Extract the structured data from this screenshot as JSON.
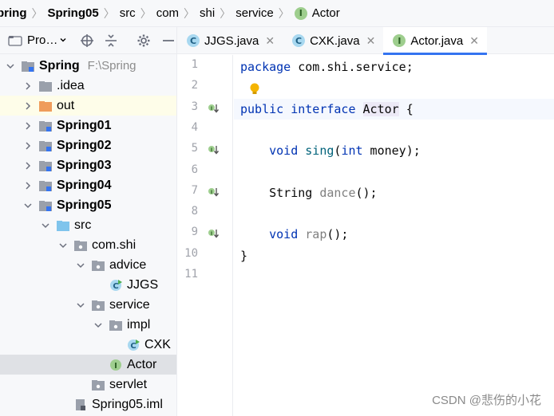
{
  "breadcrumb": {
    "items": [
      {
        "label": "pring",
        "bold": true
      },
      {
        "label": "Spring05",
        "bold": true
      },
      {
        "label": "src",
        "bold": false
      },
      {
        "label": "com",
        "bold": false
      },
      {
        "label": "shi",
        "bold": false
      },
      {
        "label": "service",
        "bold": false
      }
    ],
    "current": {
      "label": "Actor",
      "icon": "interface-icon"
    }
  },
  "project_panel": {
    "title": "Pro…",
    "toolbar": [
      "locate-icon",
      "collapse-all-icon",
      "gear-icon",
      "minimize-icon"
    ],
    "tree": [
      {
        "label": "Spring",
        "hint": "F:\\Spring",
        "bold": true,
        "expanded": true,
        "icon": "module-folder"
      },
      {
        "label": ".idea",
        "bold": false,
        "expanded": false,
        "icon": "folder"
      },
      {
        "label": "out",
        "bold": false,
        "expanded": false,
        "icon": "excluded-folder",
        "highlight": true
      },
      {
        "label": "Spring01",
        "bold": true,
        "expanded": false,
        "icon": "module-folder"
      },
      {
        "label": "Spring02",
        "bold": true,
        "expanded": false,
        "icon": "module-folder"
      },
      {
        "label": "Spring03",
        "bold": true,
        "expanded": false,
        "icon": "module-folder"
      },
      {
        "label": "Spring04",
        "bold": true,
        "expanded": false,
        "icon": "module-folder"
      },
      {
        "label": "Spring05",
        "bold": true,
        "expanded": true,
        "icon": "module-folder"
      },
      {
        "label": "src",
        "bold": false,
        "expanded": true,
        "icon": "source-folder"
      },
      {
        "label": "com.shi",
        "bold": false,
        "expanded": true,
        "icon": "package"
      },
      {
        "label": "advice",
        "bold": false,
        "expanded": true,
        "icon": "package"
      },
      {
        "label": "JJGS",
        "bold": false,
        "icon": "class"
      },
      {
        "label": "service",
        "bold": false,
        "expanded": true,
        "icon": "package"
      },
      {
        "label": "impl",
        "bold": false,
        "expanded": true,
        "icon": "package"
      },
      {
        "label": "CXK",
        "bold": false,
        "icon": "class"
      },
      {
        "label": "Actor",
        "bold": false,
        "icon": "interface",
        "selected": true
      },
      {
        "label": "servlet",
        "bold": false,
        "icon": "package"
      },
      {
        "label": "Spring05.iml",
        "bold": false,
        "icon": "iml-file"
      }
    ]
  },
  "tabs": [
    {
      "label": "JJGS.java",
      "icon": "class",
      "active": false
    },
    {
      "label": "CXK.java",
      "icon": "class",
      "active": false
    },
    {
      "label": "Actor.java",
      "icon": "interface",
      "active": true
    }
  ],
  "editor": {
    "line_numbers": [
      "1",
      "2",
      "3",
      "4",
      "5",
      "6",
      "7",
      "8",
      "9",
      "10",
      "11"
    ],
    "implemented_marker_lines": [
      "3",
      "5",
      "7",
      "9"
    ],
    "current_line": "3",
    "lines": [
      {
        "n": "1",
        "tokens": [
          {
            "t": "package",
            "c": "kw"
          },
          {
            "t": " com.shi.service;",
            "c": ""
          }
        ]
      },
      {
        "n": "2",
        "tokens": []
      },
      {
        "n": "3",
        "tokens": [
          {
            "t": "public",
            "c": "kw"
          },
          {
            "t": " ",
            "c": ""
          },
          {
            "t": "interface",
            "c": "kw"
          },
          {
            "t": " ",
            "c": ""
          },
          {
            "t": "Actor",
            "c": "ident-hl"
          },
          {
            "t": " {",
            "c": ""
          }
        ]
      },
      {
        "n": "4",
        "tokens": []
      },
      {
        "n": "5",
        "tokens": [
          {
            "t": "    ",
            "c": ""
          },
          {
            "t": "void",
            "c": "kw"
          },
          {
            "t": " ",
            "c": ""
          },
          {
            "t": "sing",
            "c": "fn"
          },
          {
            "t": "(",
            "c": ""
          },
          {
            "t": "int",
            "c": "kw"
          },
          {
            "t": " money);",
            "c": ""
          }
        ]
      },
      {
        "n": "6",
        "tokens": []
      },
      {
        "n": "7",
        "tokens": [
          {
            "t": "    String ",
            "c": ""
          },
          {
            "t": "dance",
            "c": "fn-gray"
          },
          {
            "t": "();",
            "c": ""
          }
        ]
      },
      {
        "n": "8",
        "tokens": []
      },
      {
        "n": "9",
        "tokens": [
          {
            "t": "    ",
            "c": ""
          },
          {
            "t": "void",
            "c": "kw"
          },
          {
            "t": " ",
            "c": ""
          },
          {
            "t": "rap",
            "c": "fn-gray"
          },
          {
            "t": "();",
            "c": ""
          }
        ]
      },
      {
        "n": "10",
        "tokens": [
          {
            "t": "}",
            "c": ""
          }
        ]
      },
      {
        "n": "11",
        "tokens": []
      }
    ]
  },
  "watermark": "CSDN @悲伤的小花",
  "colors": {
    "accent": "#3574f0",
    "keyword": "#0033b3",
    "method": "#00627a",
    "selection": "#dfe1e5",
    "current_line": "#f5f8fe"
  }
}
